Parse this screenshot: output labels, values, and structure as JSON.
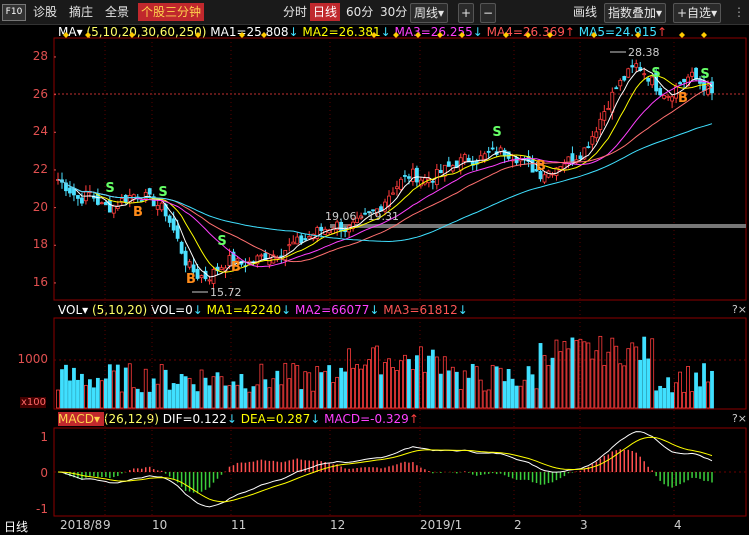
{
  "toolbar": {
    "f10": "F10",
    "diagnose": "诊股",
    "excerpt": "摘庄",
    "panorama": "全景",
    "active_tab": "个股三分钟",
    "periods": [
      "分时",
      "日线",
      "60分",
      "30分"
    ],
    "selected_period": "日线",
    "week": "周线",
    "plus": "+",
    "minus": "−",
    "draw": "画线",
    "overlay": "指数叠加",
    "watchlist": "+自选"
  },
  "ma_panel": {
    "name": "MA",
    "params": "(5,10,20,30,60,250)",
    "items": [
      {
        "label": "MA1=25.808",
        "arrow": "↓",
        "color": "#ffffff"
      },
      {
        "label": "MA2=26.381",
        "arrow": "↓",
        "color": "#ffff00"
      },
      {
        "label": "MA3=26.255",
        "arrow": "↓",
        "color": "#ff40ff"
      },
      {
        "label": "MA4=26.369",
        "arrow": "↑",
        "color": "#ff5555"
      },
      {
        "label": "MA5=24.915",
        "arrow": "↑",
        "color": "#40e0ff"
      }
    ]
  },
  "vol_panel": {
    "name": "VOL",
    "params": "(5,10,20)",
    "items": [
      {
        "label": "VOL=0",
        "arrow": "↓",
        "color": "#ffffff"
      },
      {
        "label": "MA1=42240",
        "arrow": "↓",
        "color": "#ffff00"
      },
      {
        "label": "MA2=66077",
        "arrow": "↓",
        "color": "#ff40ff"
      },
      {
        "label": "MA3=61812",
        "arrow": "↓",
        "color": "#ff5555"
      }
    ],
    "unit": "x100",
    "tick": "1000"
  },
  "macd_panel": {
    "name": "MACD",
    "params": "(26,12,9)",
    "items": [
      {
        "label": "DIF=0.122",
        "arrow": "↓",
        "color": "#ffffff"
      },
      {
        "label": "DEA=0.287",
        "arrow": "↓",
        "color": "#ffff00"
      },
      {
        "label": "MACD=-0.329",
        "arrow": "↑",
        "color": "#ff40ff"
      }
    ]
  },
  "corner_icons": "?×",
  "chart_data": {
    "type": "candlestick",
    "price_axis": {
      "ticks": [
        16,
        18,
        20,
        22,
        24,
        26,
        28
      ]
    },
    "x_labels": [
      "日线",
      "2018/8",
      "9",
      "10",
      "11",
      "12",
      "2019/1",
      "2",
      "3",
      "4"
    ],
    "annotations": {
      "high": "28.38",
      "low": "15.72",
      "range": "19.06 - 19.31"
    },
    "signals": {
      "buy": "B",
      "sell": "S"
    },
    "macd_ticks": [
      "1",
      "0",
      "-1"
    ],
    "close_path": [
      21.5,
      21.0,
      20.4,
      20.8,
      20.1,
      20.0,
      20.4,
      20.7,
      20.6,
      20.3,
      19.8,
      18.5,
      17.0,
      16.4,
      16.3,
      16.8,
      17.2,
      17.0,
      17.1,
      17.4,
      17.5,
      17.7,
      18.1,
      18.3,
      18.7,
      18.9,
      19.1,
      18.8,
      19.2,
      19.6,
      20.0,
      20.8,
      21.4,
      21.8,
      21.5,
      21.6,
      22.0,
      22.3,
      22.6,
      22.5,
      22.8,
      23.0,
      22.9,
      22.6,
      22.2,
      21.8,
      22.0,
      22.4,
      22.6,
      23.0,
      24.0,
      25.2,
      26.3,
      27.0,
      27.6,
      27.0,
      26.3,
      26.0,
      26.6,
      27.0,
      26.6,
      26.0
    ]
  }
}
